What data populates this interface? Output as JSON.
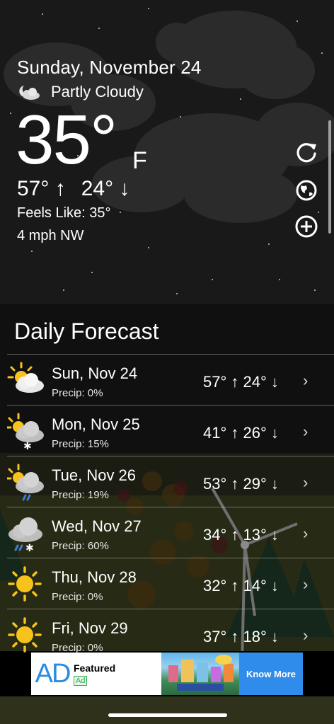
{
  "current": {
    "date": "Sunday, November 24",
    "condition": "Partly Cloudy",
    "condition_icon": "moon-cloud-icon",
    "temperature": "35°",
    "unit": "F",
    "high": "57° ↑",
    "low": "24° ↓",
    "feels_like": "Feels Like: 35°",
    "wind": "4 mph NW"
  },
  "actions": [
    {
      "name": "refresh-icon"
    },
    {
      "name": "location-globe-icon"
    },
    {
      "name": "add-location-icon"
    }
  ],
  "forecast": {
    "title": "Daily Forecast",
    "days": [
      {
        "day": "Sun, Nov 24",
        "precip": "Precip: 0%",
        "hilo": "57° ↑  24° ↓",
        "icon": "partly-cloudy-icon"
      },
      {
        "day": "Mon, Nov 25",
        "precip": "Precip: 15%",
        "hilo": "41° ↑  26° ↓",
        "icon": "partly-cloudy-snow-icon"
      },
      {
        "day": "Tue, Nov 26",
        "precip": "Precip: 19%",
        "hilo": "53° ↑  29° ↓",
        "icon": "partly-cloudy-rain-icon"
      },
      {
        "day": "Wed, Nov 27",
        "precip": "Precip: 60%",
        "hilo": "34° ↑  13° ↓",
        "icon": "cloud-rain-snow-icon"
      },
      {
        "day": "Thu, Nov 28",
        "precip": "Precip: 0%",
        "hilo": "32° ↑  14° ↓",
        "icon": "sunny-icon"
      },
      {
        "day": "Fri, Nov 29",
        "precip": "Precip: 0%",
        "hilo": "37° ↑  18° ↓",
        "icon": "sunny-icon"
      }
    ],
    "chevron": "›"
  },
  "ad": {
    "logo": "AD",
    "featured": "Featured",
    "badge": "Ad",
    "cta": "Know More"
  },
  "colors": {
    "sky": "#171717",
    "forecast_bg": "#101010",
    "accent_blue": "#2f8cea",
    "sun": "#f7c21b"
  }
}
